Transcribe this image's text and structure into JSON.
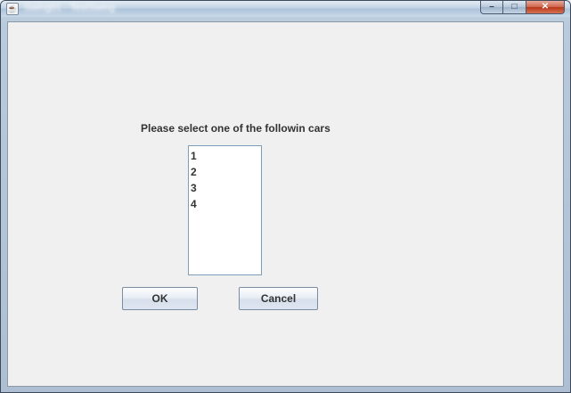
{
  "window": {
    "title": "Swing01 - TestSwing",
    "controls": {
      "minimize": "–",
      "maximize": "□",
      "close": "✕"
    }
  },
  "dialog": {
    "prompt": "Please select one of the followin cars",
    "list": {
      "items": [
        "1",
        "2",
        "3",
        "4"
      ]
    },
    "ok_label": "OK",
    "cancel_label": "Cancel"
  },
  "icons": {
    "app": "java-cup-icon"
  },
  "colors": {
    "client_bg": "#f0f0f0",
    "list_border": "#7f9db9",
    "close_button": "#c84a2c"
  }
}
